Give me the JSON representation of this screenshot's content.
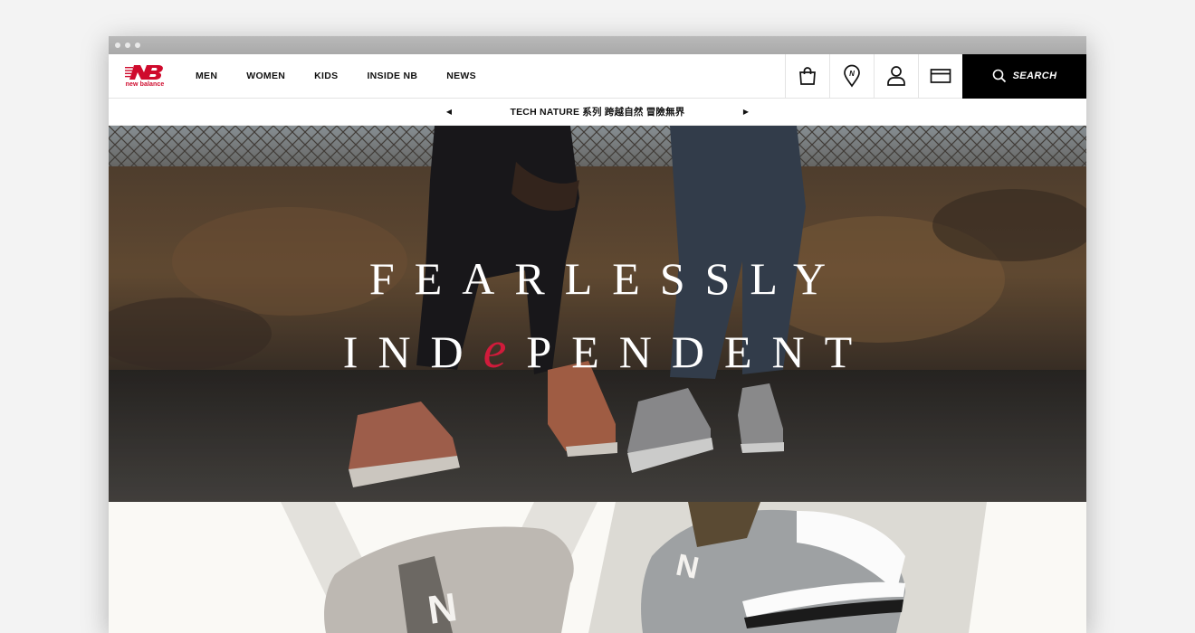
{
  "brand": {
    "logo_text": "new balance",
    "color": "#cf0a2c"
  },
  "nav": {
    "items": [
      "MEN",
      "WOMEN",
      "KIDS",
      "INSIDE NB",
      "NEWS"
    ]
  },
  "header": {
    "icons": [
      "shopping-bag-icon",
      "store-locator-icon",
      "account-icon",
      "card-icon",
      "search-icon"
    ],
    "search_label": "SEARCH"
  },
  "promo": {
    "text": "TECH NATURE 系列   跨越自然 冒險無界",
    "prev": "◀",
    "next": "▶"
  },
  "hero": {
    "line1": "FEARLESSLY",
    "line2_before": "IND",
    "line2_accent": "e",
    "line2_after": "PENDENT",
    "accent_color": "#d11b3b"
  }
}
